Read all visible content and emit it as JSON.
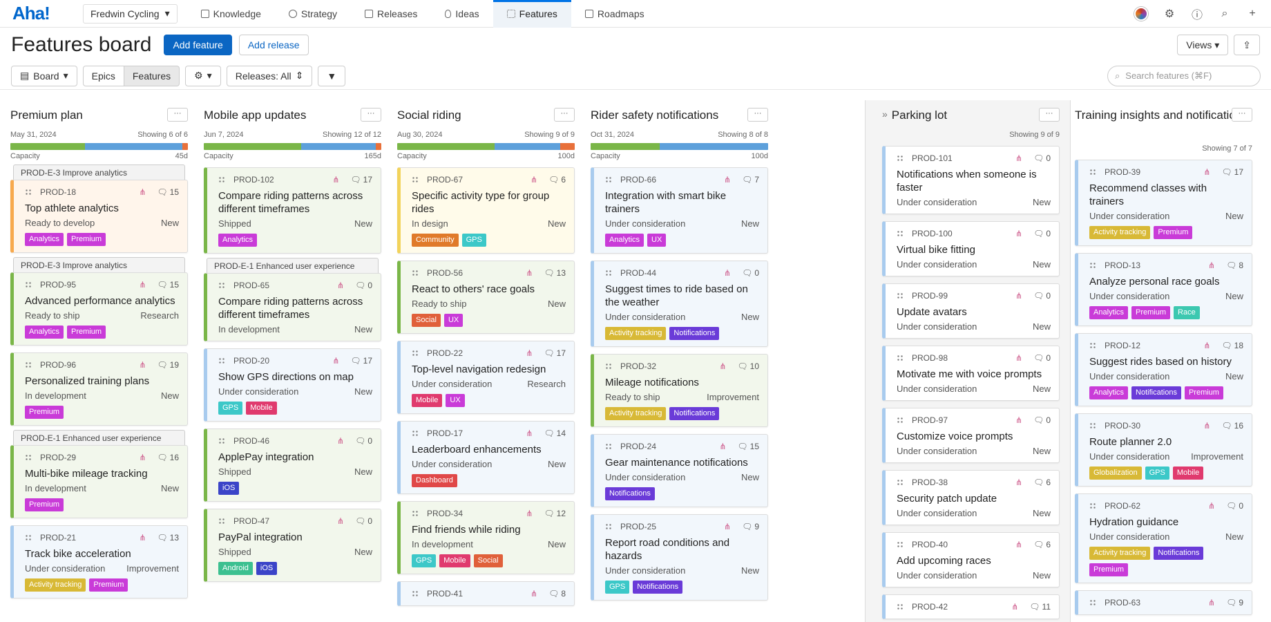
{
  "nav": {
    "logo": "Aha!",
    "workspace": "Fredwin Cycling",
    "tabs": [
      {
        "label": "Knowledge"
      },
      {
        "label": "Strategy"
      },
      {
        "label": "Releases"
      },
      {
        "label": "Ideas"
      },
      {
        "label": "Features",
        "active": true
      },
      {
        "label": "Roadmaps"
      }
    ]
  },
  "header": {
    "title": "Features board",
    "add_feature": "Add feature",
    "add_release": "Add release",
    "views": "Views"
  },
  "toolbar": {
    "board": "Board",
    "epics": "Epics",
    "features": "Features",
    "releases": "Releases: All",
    "search_placeholder": "Search features (⌘F)"
  },
  "capacity_label": "Capacity",
  "columns": [
    {
      "name": "Premium plan",
      "date": "May 31, 2024",
      "showing": "Showing 6 of 6",
      "capacity": "45d",
      "bar": [
        {
          "w": 42,
          "c": "#7ab648"
        },
        {
          "w": 55,
          "c": "#5da0db"
        },
        {
          "w": 3,
          "c": "#e8703a"
        }
      ],
      "cards": [
        {
          "epic": "PROD-E-3 Improve analytics",
          "id": "PROD-18",
          "comments": "15",
          "title": "Top athlete analytics",
          "status": "Ready to develop",
          "tail": "New",
          "color": "#f7a94d",
          "bg": "#fff5eb",
          "tags": [
            {
              "t": "Analytics",
              "c": "#c93bd8"
            },
            {
              "t": "Premium",
              "c": "#c93bd8"
            }
          ]
        },
        {
          "epic": "PROD-E-3 Improve analytics",
          "id": "PROD-95",
          "comments": "15",
          "title": "Advanced performance analytics",
          "status": "Ready to ship",
          "tail": "Research",
          "color": "#7ab648",
          "bg": "#f2f7ec",
          "tags": [
            {
              "t": "Analytics",
              "c": "#c93bd8"
            },
            {
              "t": "Premium",
              "c": "#c93bd8"
            }
          ]
        },
        {
          "id": "PROD-96",
          "comments": "19",
          "title": "Personalized training plans",
          "status": "In development",
          "tail": "New",
          "color": "#7ab648",
          "bg": "#f2f7ec",
          "tags": [
            {
              "t": "Premium",
              "c": "#c93bd8"
            }
          ]
        },
        {
          "epic": "PROD-E-1 Enhanced user experience",
          "id": "PROD-29",
          "comments": "16",
          "title": "Multi-bike mileage tracking",
          "status": "In development",
          "tail": "New",
          "color": "#7ab648",
          "bg": "#f2f7ec",
          "tags": [
            {
              "t": "Premium",
              "c": "#c93bd8"
            }
          ]
        },
        {
          "id": "PROD-21",
          "comments": "13",
          "title": "Track bike acceleration",
          "status": "Under consideration",
          "tail": "Improvement",
          "color": "#a8cbee",
          "bg": "#f2f7fc",
          "tags": [
            {
              "t": "Activity tracking",
              "c": "#d8b936"
            },
            {
              "t": "Premium",
              "c": "#c93bd8"
            }
          ]
        }
      ]
    },
    {
      "name": "Mobile app updates",
      "date": "Jun 7, 2024",
      "showing": "Showing 12 of 12",
      "capacity": "165d",
      "bar": [
        {
          "w": 55,
          "c": "#7ab648"
        },
        {
          "w": 42,
          "c": "#5da0db"
        },
        {
          "w": 3,
          "c": "#e8703a"
        }
      ],
      "cards": [
        {
          "id": "PROD-102",
          "comments": "17",
          "title": "Compare riding patterns across different timeframes",
          "status": "Shipped",
          "tail": "New",
          "color": "#7ab648",
          "bg": "#f2f7ec",
          "tags": [
            {
              "t": "Analytics",
              "c": "#c93bd8"
            }
          ]
        },
        {
          "epic": "PROD-E-1 Enhanced user experience",
          "id": "PROD-65",
          "comments": "0",
          "title": "Compare riding patterns across different timeframes",
          "status": "In development",
          "tail": "New",
          "color": "#7ab648",
          "bg": "#f2f7ec",
          "tags": []
        },
        {
          "id": "PROD-20",
          "comments": "17",
          "title": "Show GPS directions on map",
          "status": "Under consideration",
          "tail": "New",
          "color": "#a8cbee",
          "bg": "#f2f7fc",
          "tags": [
            {
              "t": "GPS",
              "c": "#3cc8c8"
            },
            {
              "t": "Mobile",
              "c": "#e03a6e"
            }
          ]
        },
        {
          "id": "PROD-46",
          "comments": "0",
          "title": "ApplePay integration",
          "status": "Shipped",
          "tail": "New",
          "color": "#7ab648",
          "bg": "#f2f7ec",
          "tags": [
            {
              "t": "iOS",
              "c": "#3b44c8"
            }
          ]
        },
        {
          "id": "PROD-47",
          "comments": "0",
          "title": "PayPal integration",
          "status": "Shipped",
          "tail": "New",
          "color": "#7ab648",
          "bg": "#f2f7ec",
          "tags": [
            {
              "t": "Android",
              "c": "#3cc090"
            },
            {
              "t": "iOS",
              "c": "#3b44c8"
            }
          ]
        }
      ]
    },
    {
      "name": "Social riding",
      "date": "Aug 30, 2024",
      "showing": "Showing 9 of 9",
      "capacity": "100d",
      "bar": [
        {
          "w": 55,
          "c": "#7ab648"
        },
        {
          "w": 37,
          "c": "#5da0db"
        },
        {
          "w": 8,
          "c": "#e8703a"
        }
      ],
      "cards": [
        {
          "id": "PROD-67",
          "comments": "6",
          "title": "Specific activity type for group rides",
          "status": "In design",
          "tail": "New",
          "color": "#f2d35b",
          "bg": "#fffbea",
          "tags": [
            {
              "t": "Community",
              "c": "#e07a2a"
            },
            {
              "t": "GPS",
              "c": "#3cc8c8"
            }
          ]
        },
        {
          "id": "PROD-56",
          "comments": "13",
          "title": "React to others' race goals",
          "status": "Ready to ship",
          "tail": "New",
          "color": "#7ab648",
          "bg": "#f2f7ec",
          "tags": [
            {
              "t": "Social",
              "c": "#e0603a"
            },
            {
              "t": "UX",
              "c": "#c93bd8"
            }
          ]
        },
        {
          "id": "PROD-22",
          "comments": "17",
          "title": "Top-level navigation redesign",
          "status": "Under consideration",
          "tail": "Research",
          "color": "#a8cbee",
          "bg": "#f2f7fc",
          "tags": [
            {
              "t": "Mobile",
              "c": "#e03a6e"
            },
            {
              "t": "UX",
              "c": "#c93bd8"
            }
          ]
        },
        {
          "id": "PROD-17",
          "comments": "14",
          "title": "Leaderboard enhancements",
          "status": "Under consideration",
          "tail": "New",
          "color": "#a8cbee",
          "bg": "#f2f7fc",
          "tags": [
            {
              "t": "Dashboard",
              "c": "#e04848"
            }
          ]
        },
        {
          "id": "PROD-34",
          "comments": "12",
          "title": "Find friends while riding",
          "status": "In development",
          "tail": "New",
          "color": "#7ab648",
          "bg": "#f2f7ec",
          "tags": [
            {
              "t": "GPS",
              "c": "#3cc8c8"
            },
            {
              "t": "Mobile",
              "c": "#e03a6e"
            },
            {
              "t": "Social",
              "c": "#e0603a"
            }
          ]
        },
        {
          "id": "PROD-41",
          "comments": "8",
          "title": "",
          "status": "",
          "tail": "",
          "color": "#a8cbee",
          "bg": "#f2f7fc",
          "tags": []
        }
      ]
    },
    {
      "name": "Rider safety notifications",
      "date": "Oct 31, 2024",
      "showing": "Showing 8 of 8",
      "capacity": "100d",
      "bar": [
        {
          "w": 39,
          "c": "#7ab648"
        },
        {
          "w": 61,
          "c": "#5da0db"
        }
      ],
      "cards": [
        {
          "id": "PROD-66",
          "comments": "7",
          "title": "Integration with smart bike trainers",
          "status": "Under consideration",
          "tail": "New",
          "color": "#a8cbee",
          "bg": "#f2f7fc",
          "tags": [
            {
              "t": "Analytics",
              "c": "#c93bd8"
            },
            {
              "t": "UX",
              "c": "#c93bd8"
            }
          ]
        },
        {
          "id": "PROD-44",
          "comments": "0",
          "title": "Suggest times to ride based on the weather",
          "status": "Under consideration",
          "tail": "New",
          "color": "#a8cbee",
          "bg": "#f2f7fc",
          "tags": [
            {
              "t": "Activity tracking",
              "c": "#d8b936"
            },
            {
              "t": "Notifications",
              "c": "#6a3bd8"
            }
          ]
        },
        {
          "id": "PROD-32",
          "comments": "10",
          "title": "Mileage notifications",
          "status": "Ready to ship",
          "tail": "Improvement",
          "color": "#7ab648",
          "bg": "#f2f7ec",
          "tags": [
            {
              "t": "Activity tracking",
              "c": "#d8b936"
            },
            {
              "t": "Notifications",
              "c": "#6a3bd8"
            }
          ]
        },
        {
          "id": "PROD-24",
          "comments": "15",
          "title": "Gear maintenance notifications",
          "status": "Under consideration",
          "tail": "New",
          "color": "#a8cbee",
          "bg": "#f2f7fc",
          "tags": [
            {
              "t": "Notifications",
              "c": "#6a3bd8"
            }
          ]
        },
        {
          "id": "PROD-25",
          "comments": "9",
          "title": "Report road conditions and hazards",
          "status": "Under consideration",
          "tail": "New",
          "color": "#a8cbee",
          "bg": "#f2f7fc",
          "tags": [
            {
              "t": "GPS",
              "c": "#3cc8c8"
            },
            {
              "t": "Notifications",
              "c": "#6a3bd8"
            }
          ]
        }
      ]
    },
    {
      "name": "Parking lot",
      "date": "",
      "showing": "Showing 9 of 9",
      "parking": true,
      "cards": [
        {
          "id": "PROD-101",
          "comments": "0",
          "title": "Notifications when someone is faster",
          "status": "Under consideration",
          "tail": "New",
          "color": "#a8cbee",
          "bg": "#fff",
          "tags": []
        },
        {
          "id": "PROD-100",
          "comments": "0",
          "title": "Virtual bike fitting",
          "status": "Under consideration",
          "tail": "New",
          "color": "#a8cbee",
          "bg": "#fff",
          "tags": []
        },
        {
          "id": "PROD-99",
          "comments": "0",
          "title": "Update avatars",
          "status": "Under consideration",
          "tail": "New",
          "color": "#a8cbee",
          "bg": "#fff",
          "tags": []
        },
        {
          "id": "PROD-98",
          "comments": "0",
          "title": "Motivate me with voice prompts",
          "status": "Under consideration",
          "tail": "New",
          "color": "#a8cbee",
          "bg": "#fff",
          "tags": []
        },
        {
          "id": "PROD-97",
          "comments": "0",
          "title": "Customize voice prompts",
          "status": "Under consideration",
          "tail": "New",
          "color": "#a8cbee",
          "bg": "#fff",
          "tags": []
        },
        {
          "id": "PROD-38",
          "comments": "6",
          "title": "Security patch update",
          "status": "Under consideration",
          "tail": "New",
          "color": "#a8cbee",
          "bg": "#fff",
          "tags": []
        },
        {
          "id": "PROD-40",
          "comments": "6",
          "title": "Add upcoming races",
          "status": "Under consideration",
          "tail": "New",
          "color": "#a8cbee",
          "bg": "#fff",
          "tags": []
        },
        {
          "id": "PROD-42",
          "comments": "11",
          "title": "",
          "status": "",
          "tail": "",
          "color": "#a8cbee",
          "bg": "#fff",
          "tags": []
        }
      ]
    },
    {
      "name": "Training insights and notifications",
      "date": "",
      "showing": "Showing 7 of 7",
      "cards": [
        {
          "id": "PROD-39",
          "comments": "17",
          "title": "Recommend classes with trainers",
          "status": "Under consideration",
          "tail": "New",
          "color": "#a8cbee",
          "bg": "#f2f7fc",
          "tags": [
            {
              "t": "Activity tracking",
              "c": "#d8b936"
            },
            {
              "t": "Premium",
              "c": "#c93bd8"
            }
          ]
        },
        {
          "id": "PROD-13",
          "comments": "8",
          "title": "Analyze personal race goals",
          "status": "Under consideration",
          "tail": "New",
          "color": "#a8cbee",
          "bg": "#f2f7fc",
          "tags": [
            {
              "t": "Analytics",
              "c": "#c93bd8"
            },
            {
              "t": "Premium",
              "c": "#c93bd8"
            },
            {
              "t": "Race",
              "c": "#3cc8b0"
            }
          ]
        },
        {
          "id": "PROD-12",
          "comments": "18",
          "title": "Suggest rides based on history",
          "status": "Under consideration",
          "tail": "New",
          "color": "#a8cbee",
          "bg": "#f2f7fc",
          "tags": [
            {
              "t": "Analytics",
              "c": "#c93bd8"
            },
            {
              "t": "Notifications",
              "c": "#6a3bd8"
            },
            {
              "t": "Premium",
              "c": "#c93bd8"
            }
          ]
        },
        {
          "id": "PROD-30",
          "comments": "16",
          "title": "Route planner 2.0",
          "status": "Under consideration",
          "tail": "Improvement",
          "color": "#a8cbee",
          "bg": "#f2f7fc",
          "tags": [
            {
              "t": "Globalization",
              "c": "#d8b936"
            },
            {
              "t": "GPS",
              "c": "#3cc8c8"
            },
            {
              "t": "Mobile",
              "c": "#e03a6e"
            }
          ]
        },
        {
          "id": "PROD-62",
          "comments": "0",
          "title": "Hydration guidance",
          "status": "Under consideration",
          "tail": "New",
          "color": "#a8cbee",
          "bg": "#f2f7fc",
          "tags": [
            {
              "t": "Activity tracking",
              "c": "#d8b936"
            },
            {
              "t": "Notifications",
              "c": "#6a3bd8"
            },
            {
              "t": "Premium",
              "c": "#c93bd8"
            }
          ]
        },
        {
          "id": "PROD-63",
          "comments": "9",
          "title": "",
          "status": "",
          "tail": "",
          "color": "#a8cbee",
          "bg": "#f2f7fc",
          "tags": []
        }
      ]
    }
  ]
}
